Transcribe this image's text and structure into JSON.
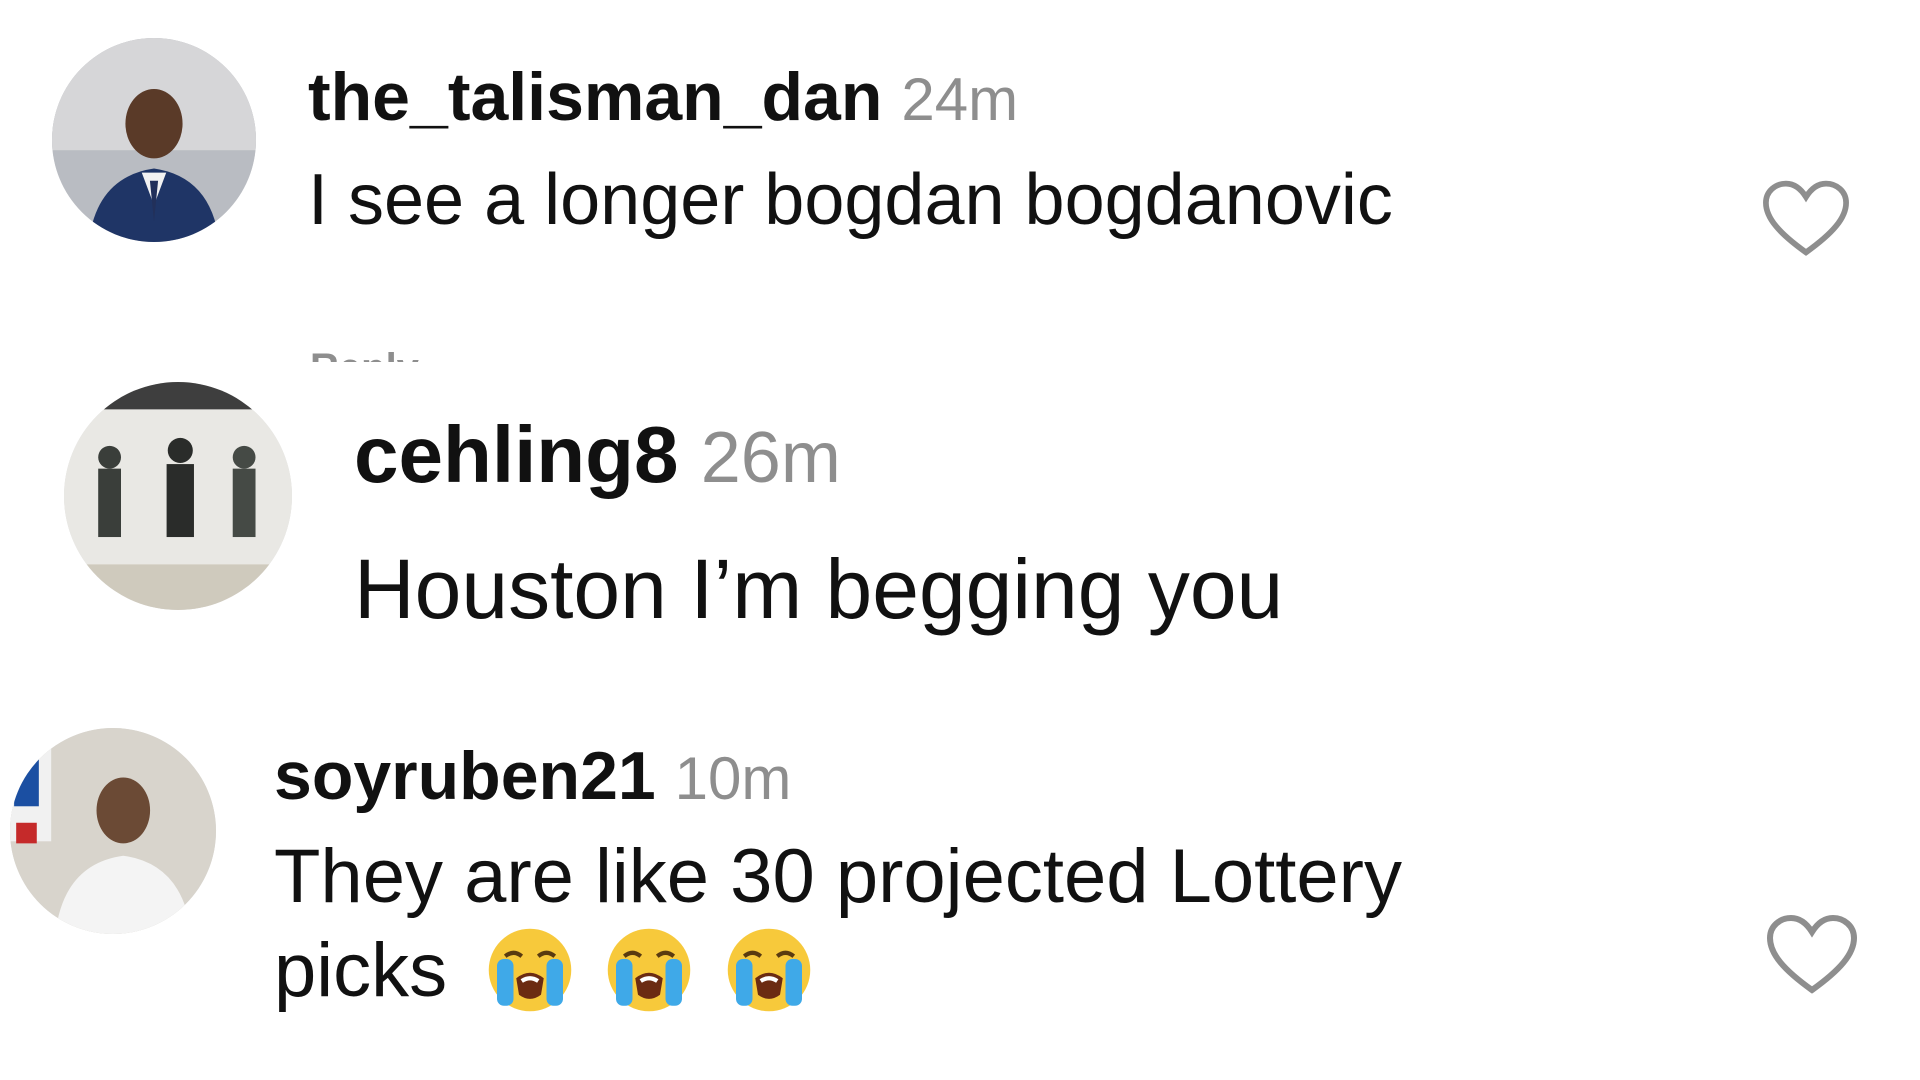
{
  "comments": [
    {
      "username": "the_talisman_dan",
      "time": "24m",
      "text": "I see a longer bogdan bogdanovic",
      "reply_label": "Reply"
    },
    {
      "username": "cehling8",
      "time": "26m",
      "text": "Houston I’m begging you"
    },
    {
      "username": "soyruben21",
      "time": "10m",
      "text_line1": "They are like 30 projected Lottery",
      "text_line2": "picks",
      "emojis": [
        "loudly-crying-face",
        "loudly-crying-face",
        "loudly-crying-face"
      ]
    }
  ],
  "icons": {
    "like": "heart-outline-icon"
  },
  "colors": {
    "text": "#111111",
    "muted": "#8e8e8e",
    "background": "#ffffff"
  }
}
